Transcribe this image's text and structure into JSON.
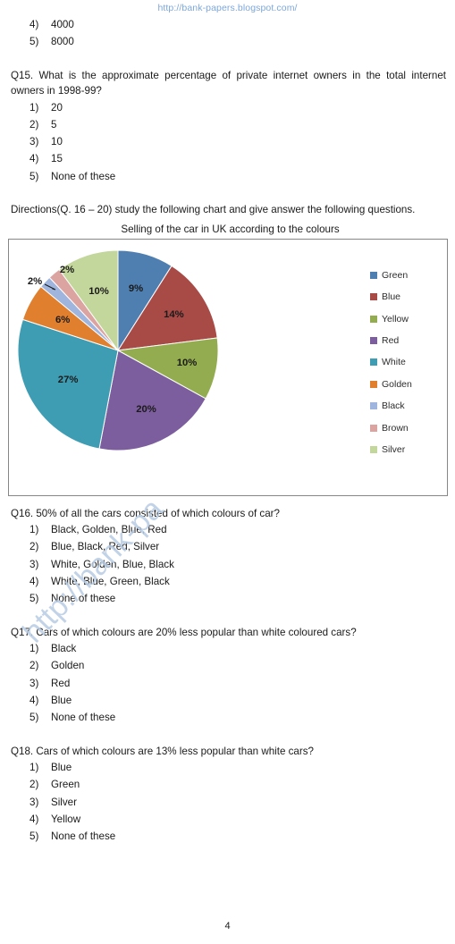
{
  "header": {
    "url": "http://bank-papers.blogspot.com/"
  },
  "watermark": {
    "text": "http://bank-pa"
  },
  "footer": {
    "page_number": "4"
  },
  "q14_tail": {
    "options": [
      {
        "num": "4)",
        "text": "4000"
      },
      {
        "num": "5)",
        "text": "8000"
      }
    ]
  },
  "q15": {
    "text": "Q15. What is the approximate percentage of private internet owners in the total internet owners in 1998-99?",
    "options": [
      {
        "num": "1)",
        "text": "20"
      },
      {
        "num": "2)",
        "text": "5"
      },
      {
        "num": "3)",
        "text": "10"
      },
      {
        "num": "4)",
        "text": "15"
      },
      {
        "num": "5)",
        "text": "None of these"
      }
    ]
  },
  "directions": {
    "text": "Directions(Q. 16 – 20) study the following chart and give answer the following questions."
  },
  "chart_data": {
    "type": "pie",
    "title": "Selling of the car in UK according to the colours",
    "xlabel": "",
    "ylabel": "",
    "legend_position": "right",
    "grid": false,
    "categories": [
      "Green",
      "Blue",
      "Yellow",
      "Red",
      "White",
      "Golden",
      "Black",
      "Brown",
      "Silver"
    ],
    "values": [
      9,
      14,
      10,
      20,
      27,
      6,
      2,
      2,
      10
    ],
    "labels": [
      "9%",
      "14%",
      "10%",
      "20%",
      "27%",
      "6%",
      "2%",
      "2%",
      "10%"
    ],
    "colors": [
      "#4f7fb1",
      "#a84b47",
      "#93ac4f",
      "#7c5e9e",
      "#3e9db3",
      "#e0802f",
      "#9fb5dd",
      "#dba4a0",
      "#c3d69b"
    ],
    "units": "percent",
    "total": 100
  },
  "q16": {
    "text": "Q16.  50% of all the cars consisted of which colours of car?",
    "options": [
      {
        "num": "1)",
        "text": "Black, Golden, Blue, Red"
      },
      {
        "num": "2)",
        "text": "Blue, Black, Red, Silver"
      },
      {
        "num": "3)",
        "text": "White, Golden, Blue, Black"
      },
      {
        "num": "4)",
        "text": "White, Blue, Green, Black"
      },
      {
        "num": "5)",
        "text": "None of these"
      }
    ]
  },
  "q17": {
    "text": "Q17. Cars of which colours are 20% less popular than white coloured cars?",
    "options": [
      {
        "num": "1)",
        "text": "Black"
      },
      {
        "num": "2)",
        "text": "Golden"
      },
      {
        "num": "3)",
        "text": "Red"
      },
      {
        "num": "4)",
        "text": "Blue"
      },
      {
        "num": "5)",
        "text": "None of these"
      }
    ]
  },
  "q18": {
    "text": "Q18. Cars of which colours are 13% less popular than white cars?",
    "options": [
      {
        "num": "1)",
        "text": "Blue"
      },
      {
        "num": "2)",
        "text": "Green"
      },
      {
        "num": "3)",
        "text": "Silver"
      },
      {
        "num": "4)",
        "text": "Yellow"
      },
      {
        "num": "5)",
        "text": "None of these"
      }
    ]
  }
}
